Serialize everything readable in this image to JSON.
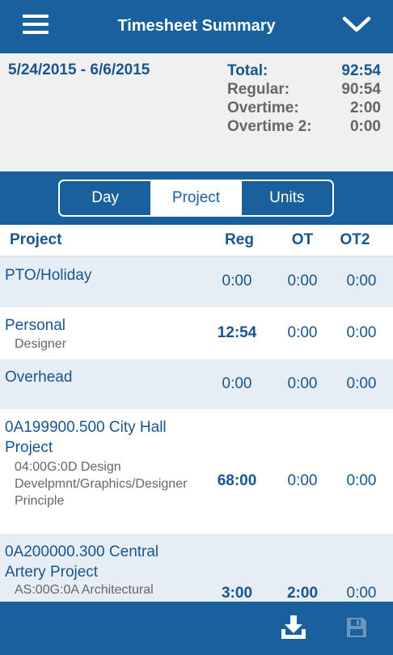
{
  "header": {
    "title": "Timesheet Summary",
    "menu_icon": "hamburger-menu-icon",
    "dropdown_icon": "chevron-down-icon"
  },
  "summary": {
    "date_range": "5/24/2015 - 6/6/2015",
    "total_label": "Total:",
    "total_value": "92:54",
    "regular_label": "Regular:",
    "regular_value": "90:54",
    "overtime_label": "Overtime:",
    "overtime_value": "2:00",
    "overtime2_label": "Overtime 2:",
    "overtime2_value": "0:00"
  },
  "tabs": {
    "day": "Day",
    "project": "Project",
    "units": "Units",
    "active": "Project"
  },
  "columns": {
    "project": "Project",
    "reg": "Reg",
    "ot": "OT",
    "ot2": "OT2"
  },
  "rows": [
    {
      "name": "PTO/Holiday",
      "sub": "",
      "reg": "0:00",
      "ot": "0:00",
      "ot2": "0:00"
    },
    {
      "name": "Personal",
      "sub": "Designer",
      "reg": "12:54",
      "ot": "0:00",
      "ot2": "0:00"
    },
    {
      "name": "Overhead",
      "sub": "",
      "reg": "0:00",
      "ot": "0:00",
      "ot2": "0:00"
    },
    {
      "name": "0A199900.500 City Hall Project",
      "sub": "04:00G:0D Design Develpmnt/Graphics/Designer Principle",
      "reg": "68:00",
      "ot": "0:00",
      "ot2": "0:00"
    },
    {
      "name": "0A200000.300 Central Artery Project",
      "sub": "AS:00G:0A Architectural",
      "reg": "3:00",
      "ot": "2:00",
      "ot2": "0:00"
    }
  ],
  "footer": {
    "download_icon": "download-icon",
    "save_icon": "save-icon"
  },
  "colors": {
    "brand": "#18619c",
    "text_blue": "#18558e",
    "row_alt": "#e7edf4",
    "summary_bg": "#f0f0f0"
  }
}
